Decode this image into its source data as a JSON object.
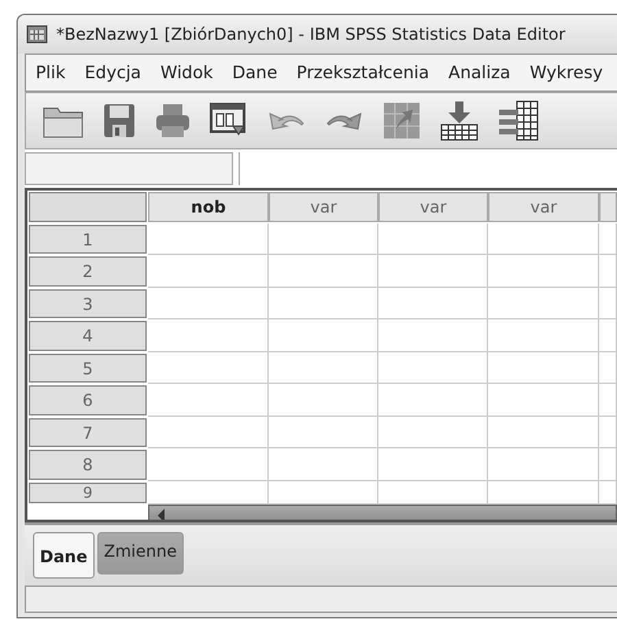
{
  "window": {
    "title": "*BezNazwy1 [ZbiórDanych0] - IBM SPSS Statistics Data Editor"
  },
  "menu": [
    {
      "label": "Plik"
    },
    {
      "label": "Edycja"
    },
    {
      "label": "Widok"
    },
    {
      "label": "Dane"
    },
    {
      "label": "Przekształcenia"
    },
    {
      "label": "Analiza"
    },
    {
      "label": "Wykresy"
    }
  ],
  "toolbar": [
    {
      "kind": "open"
    },
    {
      "kind": "save"
    },
    {
      "kind": "print"
    },
    {
      "kind": "dialog"
    },
    {
      "kind": "undo"
    },
    {
      "kind": "redo"
    },
    {
      "kind": "goto"
    },
    {
      "kind": "insert"
    },
    {
      "kind": "vars"
    }
  ],
  "table": {
    "columns": [
      {
        "label": "nob",
        "bold": true
      },
      {
        "label": "var",
        "bold": false
      },
      {
        "label": "var",
        "bold": false
      },
      {
        "label": "var",
        "bold": false
      }
    ],
    "rows": [
      "1",
      "2",
      "3",
      "4",
      "5",
      "6",
      "7",
      "8",
      "9"
    ]
  },
  "tabs": [
    {
      "label": "Dane",
      "selected": true
    },
    {
      "label": "Zmienne",
      "selected": false
    }
  ]
}
